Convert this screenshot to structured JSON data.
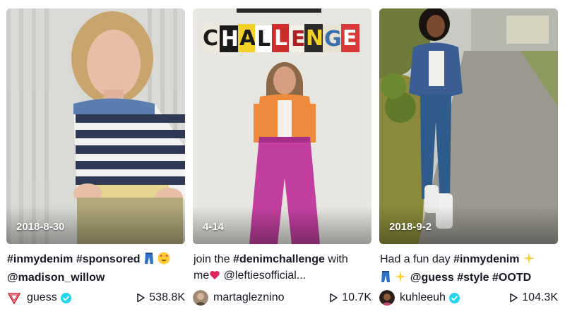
{
  "videos": [
    {
      "date": "2018-8-30",
      "caption_line1": [
        {
          "text": "#inmydenim",
          "tag": true
        },
        {
          "text": " ",
          "tag": false
        },
        {
          "text": "#sponsored",
          "tag": true
        }
      ],
      "caption_line2": [
        {
          "text": "@madison_willow",
          "tag": true
        }
      ],
      "username": "guess",
      "verified": true,
      "views": "538.8K",
      "colors": {
        "bg": "#d9d9d6",
        "shirt_stripe_a": "#2e3a55",
        "shirt_stripe_b": "#f2f2f0",
        "hem": "#e6d58c",
        "skin": "#e8bfa6",
        "hair": "#c9a46c"
      }
    },
    {
      "date": "4-14",
      "caption_line1": [
        {
          "text": "join the ",
          "tag": false
        },
        {
          "text": "#denimchallenge",
          "tag": true
        },
        {
          "text": " with",
          "tag": false
        }
      ],
      "caption_line2": [
        {
          "text": "me",
          "tag": false
        },
        {
          "text": " @leftiesofficial...",
          "tag": false
        }
      ],
      "username": "martagleznino",
      "verified": false,
      "views": "10.7K",
      "banner": "CHALLENGE",
      "colors": {
        "bg": "#e8e6e1",
        "top": "#ef8a3c",
        "pants": "#c23fa0",
        "skin": "#d6a080",
        "hair": "#8a6848"
      }
    },
    {
      "date": "2018-9-2",
      "caption_line1": [
        {
          "text": "Had a fun day ",
          "tag": false
        },
        {
          "text": "#inmydenim",
          "tag": true
        }
      ],
      "caption_line2": [
        {
          "text": "@guess",
          "tag": true
        },
        {
          "text": " ",
          "tag": false
        },
        {
          "text": "#style",
          "tag": true
        },
        {
          "text": " ",
          "tag": false
        },
        {
          "text": "#OOTD",
          "tag": true
        }
      ],
      "username": "kuhleeuh",
      "verified": true,
      "views": "104.3K",
      "colors": {
        "road": "#9a9890",
        "grass": "#8a8a3a",
        "jacket": "#3a5d94",
        "jeans": "#2f5a8c",
        "boots": "#f0f0ee",
        "skin": "#7a4a30"
      }
    }
  ],
  "icons": {
    "verified": "verified-badge-icon",
    "play": "play-count-icon",
    "jeans": "jeans-emoji",
    "heart_eyes": "heart-eyes-emoji",
    "sparkles": "sparkles-emoji",
    "heart": "red-heart-emoji"
  },
  "accent": "#20d5ec"
}
